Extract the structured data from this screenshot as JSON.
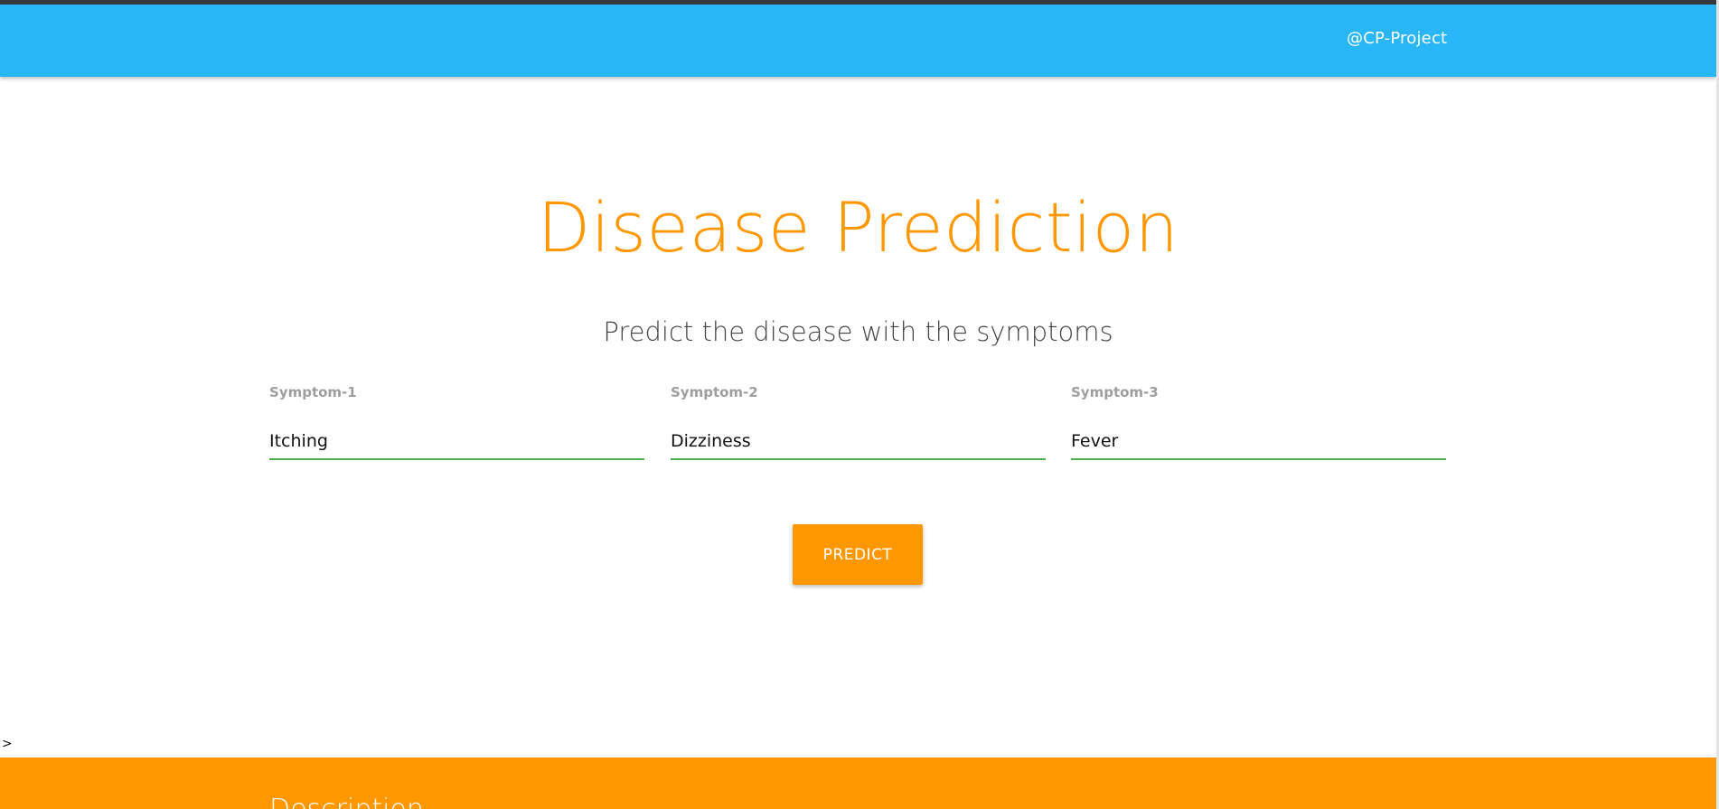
{
  "navbar": {
    "brand": "@CP-Project",
    "background": "#29b6f6"
  },
  "main": {
    "title": "Disease Prediction",
    "subtitle": "Predict the disease with the symptoms",
    "accent": "#ff9800",
    "fields": [
      {
        "label": "Symptom-1",
        "value": "Itching"
      },
      {
        "label": "Symptom-2",
        "value": "Dizziness"
      },
      {
        "label": "Symptom-3",
        "value": "Fever"
      }
    ],
    "predict_label": "PREDICT"
  },
  "stray_text": ">",
  "footer": {
    "heading": "Description"
  }
}
